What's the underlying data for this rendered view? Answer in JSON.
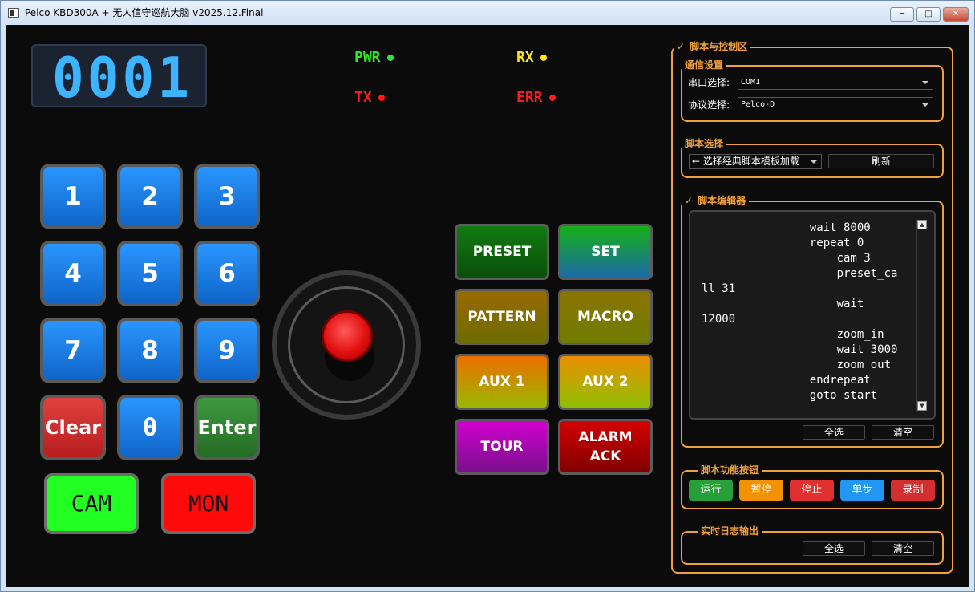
{
  "window": {
    "title": "Pelco KBD300A + 无人值守巡航大脑 v2025.12.Final",
    "min": "─",
    "max": "□",
    "close": "✕"
  },
  "display": {
    "value": "0001"
  },
  "indicators": [
    {
      "label": "PWR",
      "color": "#2ee82e"
    },
    {
      "label": "RX",
      "color": "#ffe41a"
    },
    {
      "label": "TX",
      "color": "#ff1a1a"
    },
    {
      "label": "ERR",
      "color": "#ff1a1a"
    }
  ],
  "keypad": {
    "k1": "1",
    "k2": "2",
    "k3": "3",
    "k4": "4",
    "k5": "5",
    "k6": "6",
    "k7": "7",
    "k8": "8",
    "k9": "9",
    "clear": "Clear",
    "k0": "0",
    "enter": "Enter",
    "cam": "CAM",
    "mon": "MON"
  },
  "functions": {
    "preset": "PRESET",
    "set": "SET",
    "pattern": "PATTERN",
    "macro": "MACRO",
    "aux1": "AUX 1",
    "aux2": "AUX 2",
    "tour": "TOUR",
    "alarm_ack": "ALARM\nACK"
  },
  "panel": {
    "title": "脚本与控制区",
    "check": "✓",
    "comm": {
      "title": "通信设置",
      "port_label": "串口选择:",
      "port_value": "COM1",
      "protocol_label": "协议选择:",
      "protocol_value": "Pelco-D"
    },
    "script_select": {
      "title": "脚本选择",
      "combo": "← 选择经典脚本模板加载",
      "refresh": "刷新"
    },
    "editor": {
      "title": "脚本编辑器",
      "check": "✓",
      "code": "                wait 8000\n                repeat 0\n                    cam 3\n                    preset_ca\nll 31\n                    wait\n12000\n                    zoom_in\n                    wait 3000\n                    zoom_out\n                endrepeat\n                goto start",
      "select_all": "全选",
      "clear": "清空"
    },
    "actions": {
      "title": "脚本功能按钮",
      "run": "运行",
      "pause": "暂停",
      "stop": "停止",
      "step": "单步",
      "record": "录制"
    },
    "log": {
      "title": "实时日志输出",
      "select_all": "全选",
      "clear": "清空"
    }
  },
  "colors": {
    "accent": "#f0a03c",
    "key_blue": "#1a7ee6",
    "cam_green": "#22ff22",
    "mon_red": "#ff0a0a"
  }
}
